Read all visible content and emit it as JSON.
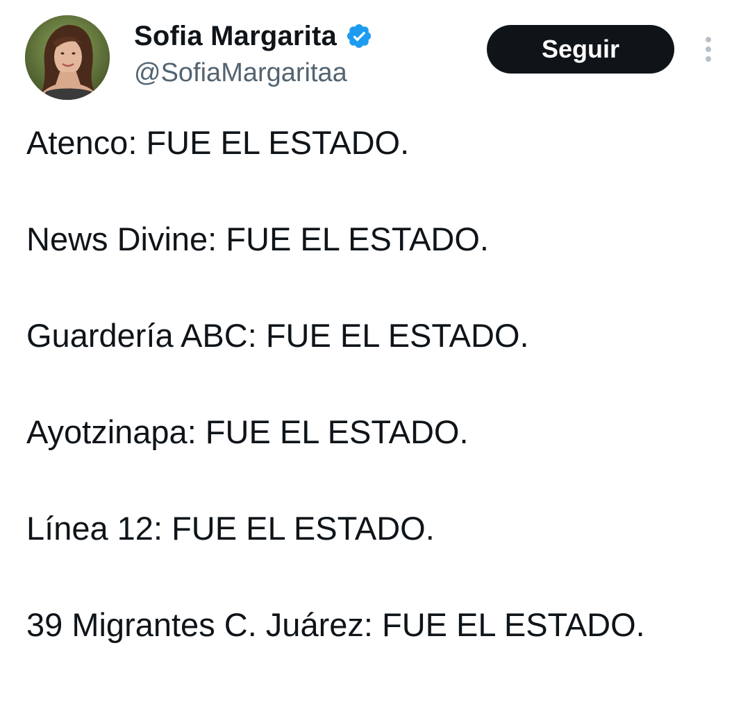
{
  "author": {
    "display_name": "Sofia Margarita",
    "handle": "@SofiaMargaritaa",
    "verified": true,
    "avatar_icon": "profile-photo"
  },
  "actions": {
    "follow_label": "Seguir",
    "more_icon": "more-vertical-icon"
  },
  "tweet": {
    "lines": [
      "Atenco: FUE EL ESTADO.",
      "News Divine: FUE EL ESTADO.",
      "Guardería ABC: FUE EL ESTADO.",
      "Ayotzinapa: FUE EL ESTADO.",
      "Línea 12: FUE EL ESTADO.",
      "39 Migrantes C. Juárez: FUE EL ESTADO."
    ]
  },
  "colors": {
    "text": "#0f1419",
    "secondary_text": "#536471",
    "verified_badge": "#1d9bf0",
    "button_bg": "#0f1419",
    "button_text": "#ffffff"
  }
}
